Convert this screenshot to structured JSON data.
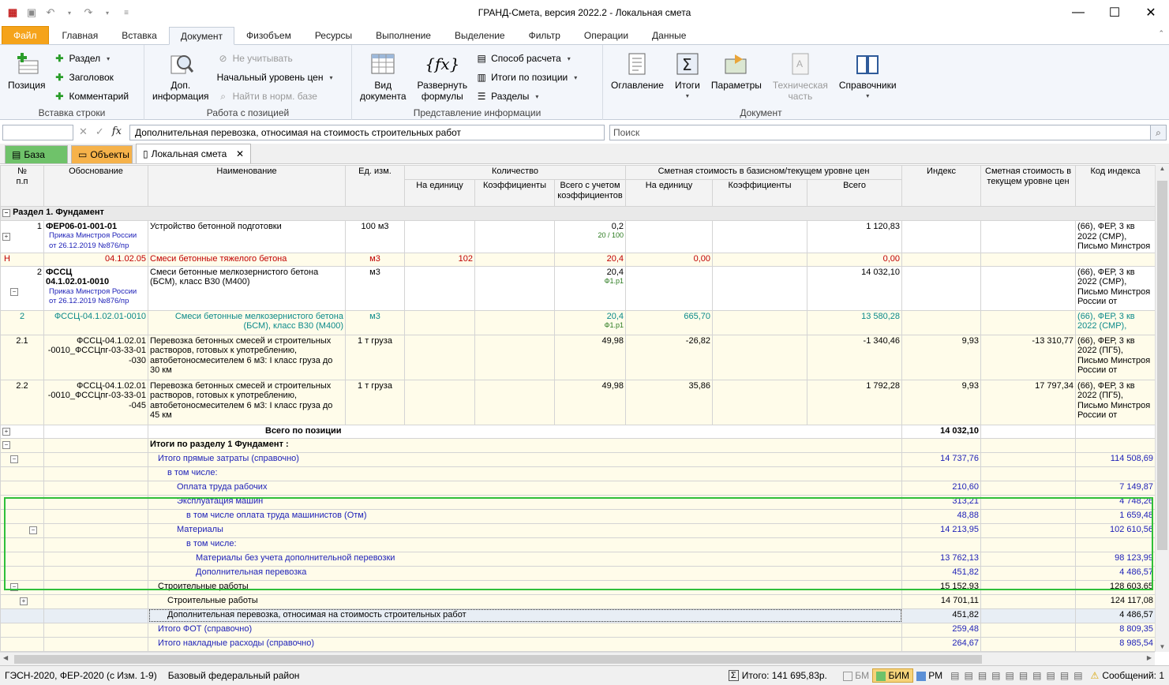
{
  "window": {
    "title": "ГРАНД-Смета, версия 2022.2 - Локальная смета"
  },
  "ribbon_tabs": [
    "Файл",
    "Главная",
    "Вставка",
    "Документ",
    "Физобъем",
    "Ресурсы",
    "Выполнение",
    "Выделение",
    "Фильтр",
    "Операции",
    "Данные"
  ],
  "ribbon": {
    "insert_row": {
      "label": "Вставка строки",
      "position": "Позиция",
      "section": "Раздел",
      "header": "Заголовок",
      "comment": "Комментарий"
    },
    "position_work": {
      "label": "Работа с позицией",
      "extra_info": "Доп.\nинформация",
      "ignore": "Не учитывать",
      "price_level": "Начальный уровень цен",
      "find_base": "Найти в норм. базе"
    },
    "presentation": {
      "label": "Представление информации",
      "doc_view": "Вид\nдокумента",
      "expand_formulas": "Развернуть\nформулы",
      "calc_method": "Способ расчета",
      "position_totals": "Итоги по позиции",
      "sections": "Разделы"
    },
    "document": {
      "label": "Документ",
      "toc": "Оглавление",
      "totals": "Итоги",
      "params": "Параметры",
      "tech_part": "Техническая\nчасть",
      "references": "Справочники"
    }
  },
  "formula_bar": {
    "value": "Дополнительная перевозка, относимая на стоимость строительных работ",
    "search_placeholder": "Поиск"
  },
  "doc_tabs": {
    "base": "База",
    "objects": "Объекты",
    "local": "Локальная смета"
  },
  "headers": {
    "num": "№\nп.п",
    "basis": "Обоснование",
    "name": "Наименование",
    "unit": "Ед. изм.",
    "qty": "Количество",
    "qty_unit": "На единицу",
    "qty_coef": "Коэффициенты",
    "qty_total": "Всего с учетом\nкоэффициентов",
    "cost": "Сметная стоимость в базисном/текущем уровне цен",
    "cost_unit": "На единицу",
    "cost_coef": "Коэффициенты",
    "cost_total": "Всего",
    "index": "Индекс",
    "cost_current": "Сметная стоимость в\nтекущем уровне цен",
    "index_code": "Код индекса"
  },
  "section_title": "Раздел 1. Фундамент",
  "rows": {
    "r1": {
      "num": "1",
      "code": "ФЕР06-01-001-01",
      "order": "Приказ Минстроя России\nот 26.12.2019 №876/пр",
      "name": "Устройство бетонной подготовки",
      "unit": "100 м3",
      "qty_total": "0,2",
      "qty_formula": "20 / 100",
      "total": "1 120,83",
      "idx": "(66), ФЕР, 3 кв\n2022 (СМР),\nПисьмо Минстроя"
    },
    "rh": {
      "mark": "Н",
      "code": "04.1.02.05",
      "name": "Смеси бетонные тяжелого бетона",
      "unit": "м3",
      "qty_unit": "102",
      "qty_total": "20,4",
      "cost_unit": "0,00",
      "total": "0,00"
    },
    "r2": {
      "num": "2",
      "code": "ФССЦ\n04.1.02.01-0010",
      "order": "Приказ Минстроя России\nот 26.12.2019 №876/пр",
      "name": "Смеси бетонные мелкозернистого бетона\n(БСМ), класс В30 (М400)",
      "unit": "м3",
      "qty_total": "20,4",
      "qty_formula": "Ф1.р1",
      "total": "14 032,10",
      "idx": "(66), ФЕР, 3 кв\n2022 (СМР),\nПисьмо Минстроя\nРоссии от"
    },
    "r2b": {
      "num": "2",
      "code": "ФССЦ-04.1.02.01-0010",
      "name": "Смеси бетонные мелкозернистого бетона\n(БСМ), класс В30 (М400)",
      "unit": "м3",
      "qty_total": "20,4",
      "qty_formula": "Ф1.р1",
      "cost_unit": "665,70",
      "total": "13 580,28",
      "idx": "(66), ФЕР, 3 кв\n2022 (СМР),"
    },
    "r21": {
      "num": "2.1",
      "code": "ФССЦ-04.1.02.01\n-0010_ФССЦпг-03-33-01\n-030",
      "name": "Перевозка бетонных смесей и строительных\nрастворов, готовых к употреблению,\nавтобетоносмесителем 6 м3: I класс груза до\n30 км",
      "unit": "1 т груза",
      "qty_total": "49,98",
      "cost_unit": "-26,82",
      "total": "-1 340,46",
      "index": "9,93",
      "cur": "-13 310,77",
      "idx": "(66), ФЕР, 3 кв\n2022 (ПГ5),\nПисьмо Минстроя\nРоссии от"
    },
    "r22": {
      "num": "2.2",
      "code": "ФССЦ-04.1.02.01\n-0010_ФССЦпг-03-33-01\n-045",
      "name": "Перевозка бетонных смесей и строительных\nрастворов, готовых к употреблению,\nавтобетоносмесителем 6 м3: I класс груза до\n45 км",
      "unit": "1 т груза",
      "qty_total": "49,98",
      "cost_unit": "35,86",
      "total": "1 792,28",
      "index": "9,93",
      "cur": "17 797,34",
      "idx": "(66), ФЕР, 3 кв\n2022 (ПГ5),\nПисьмо Минстроя\nРоссии от"
    }
  },
  "totals": [
    {
      "label": "Всего по позиции",
      "total": "14 032,10",
      "cur": ""
    },
    {
      "label": "Итоги по разделу 1 Фундамент :",
      "total": "",
      "cur": ""
    },
    {
      "label": "Итого прямые затраты (справочно)",
      "total": "14 737,76",
      "cur": "114 508,69"
    },
    {
      "label": "в том числе:",
      "total": "",
      "cur": ""
    },
    {
      "label": "Оплата труда рабочих",
      "total": "210,60",
      "cur": "7 149,87"
    },
    {
      "label": "Эксплуатация машин",
      "total": "313,21",
      "cur": "4 748,26"
    },
    {
      "label": "в том числе оплата труда машинистов (Отм)",
      "total": "48,88",
      "cur": "1 659,48"
    },
    {
      "label": "Материалы",
      "total": "14 213,95",
      "cur": "102 610,56"
    },
    {
      "label": "в том числе:",
      "total": "",
      "cur": ""
    },
    {
      "label": "Материалы без учета дополнительной перевозки",
      "total": "13 762,13",
      "cur": "98 123,99"
    },
    {
      "label": "Дополнительная перевозка",
      "total": "451,82",
      "cur": "4 486,57"
    },
    {
      "label": "Строительные работы",
      "total": "15 152,93",
      "cur": "128 603,65"
    },
    {
      "label": "Строительные работы",
      "total": "14 701,11",
      "cur": "124 117,08"
    },
    {
      "label": "Дополнительная перевозка, относимая на стоимость строительных работ",
      "total": "451,82",
      "cur": "4 486,57"
    },
    {
      "label": "Итого ФОТ (справочно)",
      "total": "259,48",
      "cur": "8 809,35"
    },
    {
      "label": "Итого накладные расходы (справочно)",
      "total": "264,67",
      "cur": "8 985,54"
    }
  ],
  "status": {
    "norms": "ГЭСН-2020, ФЕР-2020 (с Изм. 1-9)",
    "region": "Базовый федеральный район",
    "sum": "Итого: 141 695,83р.",
    "bm": "БМ",
    "bim": "БИМ",
    "rm": "РМ",
    "messages": "Сообщений: 1"
  }
}
